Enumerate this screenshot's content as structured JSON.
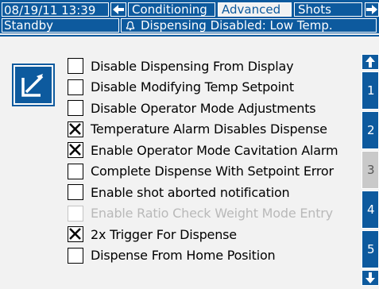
{
  "header": {
    "datetime": "08/19/11 13:39",
    "tabs": [
      {
        "label": "Conditioning",
        "active": false
      },
      {
        "label": "Advanced",
        "active": true
      },
      {
        "label": "Shots",
        "active": false
      }
    ]
  },
  "status": {
    "mode": "Standby",
    "message": "Dispensing Disabled: Low Temp."
  },
  "options": [
    {
      "label": "Disable Dispensing From Display",
      "checked": false,
      "enabled": true
    },
    {
      "label": "Disable Modifying Temp Setpoint",
      "checked": false,
      "enabled": true
    },
    {
      "label": "Disable Operator Mode Adjustments",
      "checked": false,
      "enabled": true
    },
    {
      "label": "Temperature Alarm Disables Dispense",
      "checked": true,
      "enabled": true
    },
    {
      "label": "Enable Operator Mode Cavitation Alarm",
      "checked": true,
      "enabled": true
    },
    {
      "label": "Complete Dispense With Setpoint Error",
      "checked": false,
      "enabled": true
    },
    {
      "label": "Enable shot aborted notification",
      "checked": false,
      "enabled": true
    },
    {
      "label": "Enable Ratio Check Weight Mode Entry",
      "checked": false,
      "enabled": false
    },
    {
      "label": "2x Trigger For Dispense",
      "checked": true,
      "enabled": true
    },
    {
      "label": "Dispense From Home Position",
      "checked": false,
      "enabled": true
    }
  ],
  "sidebar": {
    "pages": [
      "1",
      "2",
      "3",
      "4",
      "5"
    ],
    "selected_page": "3"
  },
  "icons": {
    "back": "left-arrow-icon",
    "forward": "right-arrow-icon",
    "alarm": "bell-icon",
    "edit": "edit-icon",
    "scroll_up": "up-arrow-icon",
    "scroll_down": "down-arrow-icon"
  },
  "colors": {
    "accent": "#0d5a9e",
    "background": "#f2f2f2",
    "disabled_text": "#b9b9b9"
  }
}
